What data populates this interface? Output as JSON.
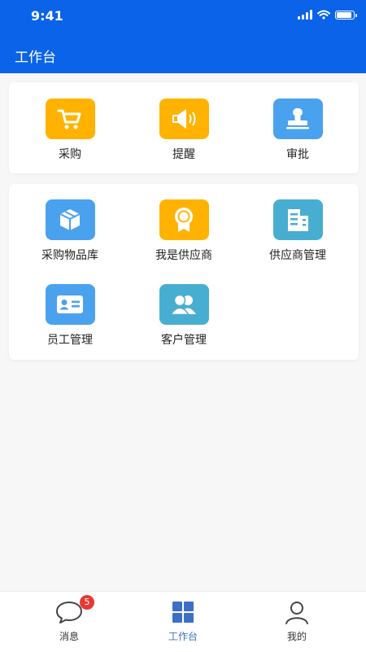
{
  "status_bar": {
    "time": "9:41"
  },
  "header": {
    "title": "工作台"
  },
  "top_actions": [
    {
      "label": "采购",
      "icon": "shopping-cart-icon"
    },
    {
      "label": "提醒",
      "icon": "speaker-icon"
    },
    {
      "label": "审批",
      "icon": "stamp-icon"
    }
  ],
  "modules": [
    {
      "label": "采购物品库",
      "icon": "box-icon"
    },
    {
      "label": "我是供应商",
      "icon": "award-ribbon-icon"
    },
    {
      "label": "供应商管理",
      "icon": "building-icon"
    },
    {
      "label": "员工管理",
      "icon": "id-card-icon"
    },
    {
      "label": "客户管理",
      "icon": "users-icon"
    }
  ],
  "tabbar": {
    "items": [
      {
        "label": "消息",
        "badge": "5",
        "icon": "chat-bubble-icon"
      },
      {
        "label": "工作台",
        "icon": "grid-icon",
        "active": true
      },
      {
        "label": "我的",
        "icon": "person-icon"
      }
    ]
  },
  "colors": {
    "primary": "#0a63e8",
    "orange": "#ffb300",
    "blue": "#4aa1ee",
    "teal": "#47aed2",
    "badge": "#e53935"
  }
}
